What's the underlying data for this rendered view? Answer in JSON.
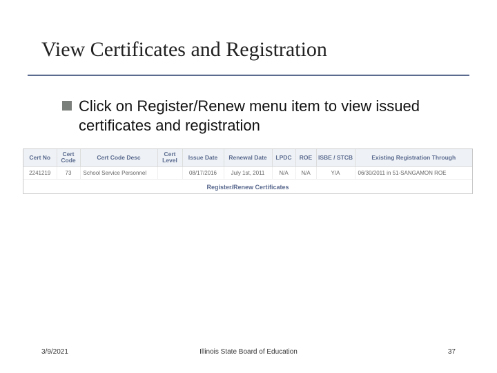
{
  "title": "View Certificates and Registration",
  "bullet": "Click on Register/Renew menu item to view issued certificates and registration",
  "table": {
    "headers": [
      "Cert No",
      "Cert Code",
      "Cert Code Desc",
      "Cert Level",
      "Issue Date",
      "Renewal Date",
      "LPDC",
      "ROE",
      "ISBE / STCB",
      "Existing Registration Through"
    ],
    "row": {
      "cert_no": "2241219",
      "cert_code": "73",
      "cert_desc": "School Service Personnel",
      "cert_level": "",
      "issue_date": "08/17/2016",
      "renewal_date": "July 1st, 2011",
      "lpdc": "N/A",
      "roe": "N/A",
      "isbe": "Y/A",
      "existing": "06/30/2011 in 51-SANGAMON ROE"
    },
    "link": "Register/Renew Certificates"
  },
  "footer": {
    "date": "3/9/2021",
    "org": "Illinois State Board of Education",
    "page": "37"
  }
}
